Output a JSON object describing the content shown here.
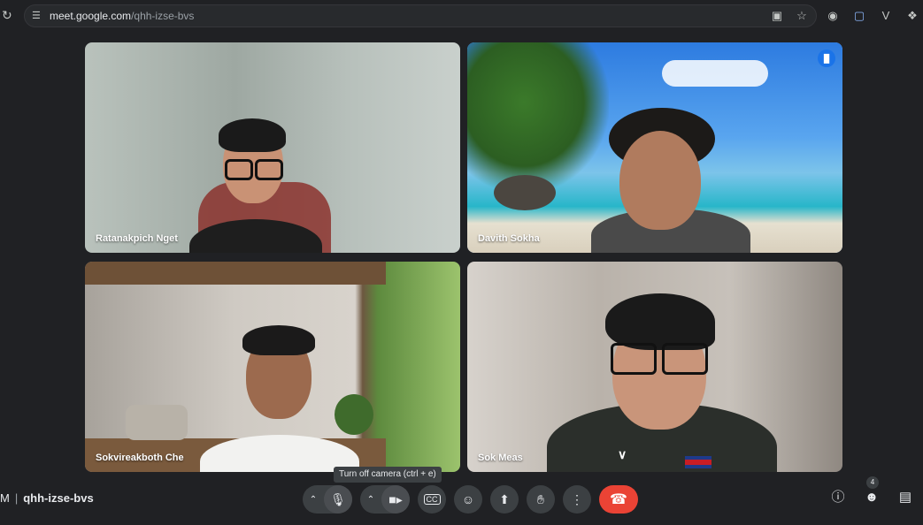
{
  "browser": {
    "url_host": "meet.google.com",
    "url_path": "/qhh-izse-bvs"
  },
  "tiles": [
    {
      "name": "Ratanakpich Nget",
      "speaking": false
    },
    {
      "name": "Davith Sokha",
      "speaking": true
    },
    {
      "name": "Sokvireakboth Che",
      "speaking": false
    },
    {
      "name": "Sok Meas",
      "speaking": false
    }
  ],
  "tooltip": "Turn off camera (ctrl + e)",
  "meeting": {
    "time_fragment": "M",
    "separator": "|",
    "code": "qhh-izse-bvs",
    "people_count": "4"
  },
  "colors": {
    "leave_button": "#ea4335",
    "active_speaker_outline": "#8ab4f8",
    "speaking_badge": "#1a73e8"
  }
}
